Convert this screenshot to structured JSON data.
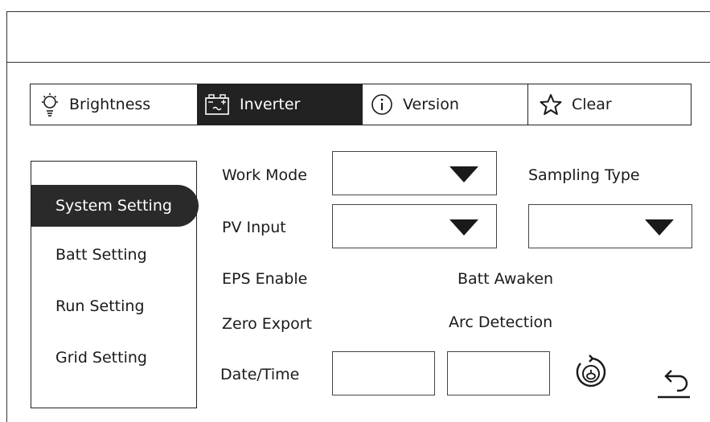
{
  "tabs": [
    {
      "label": "Brightness",
      "icon": "bulb-icon"
    },
    {
      "label": "Inverter",
      "icon": "battery-icon"
    },
    {
      "label": "Version",
      "icon": "info-icon"
    },
    {
      "label": "Clear",
      "icon": "star-icon"
    }
  ],
  "active_tab": "Inverter",
  "sidebar": {
    "items": [
      {
        "label": "System Setting",
        "active": true
      },
      {
        "label": "Batt Setting",
        "active": false
      },
      {
        "label": "Run Setting",
        "active": false
      },
      {
        "label": "Grid Setting",
        "active": false
      }
    ]
  },
  "form": {
    "work_mode_label": "Work Mode",
    "sampling_type_label": "Sampling Type",
    "pv_input_label": "PV Input",
    "eps_enable_label": "EPS Enable",
    "batt_awaken_label": "Batt Awaken",
    "zero_export_label": "Zero Export",
    "arc_detection_label": "Arc Detection",
    "date_time_label": "Date/Time",
    "work_mode_value": "",
    "pv_input_value": "",
    "sampling_type_value": "",
    "date_value": "",
    "time_value": ""
  },
  "icons": {
    "refresh": "refresh-icon",
    "back": "back-icon"
  },
  "colors": {
    "active_bg": "#222222",
    "active_fg": "#ffffff",
    "border": "#222222"
  }
}
